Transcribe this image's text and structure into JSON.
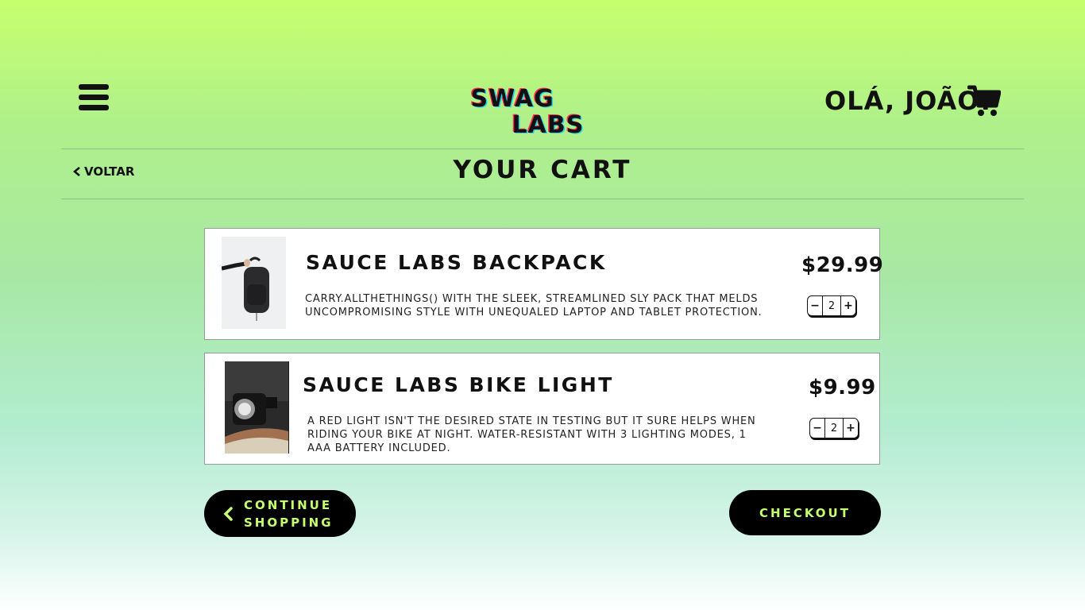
{
  "header": {
    "logo": {
      "line1": "SWAG",
      "line2": "LABS"
    },
    "greeting": "OLÁ, JOÃO!",
    "menu_icon": "hamburger-menu-icon",
    "cart_icon": "shopping-cart-icon"
  },
  "subheader": {
    "back_label": "VOLTAR",
    "title": "YOUR CART"
  },
  "cart": {
    "items": [
      {
        "name": "SAUCE LABS BACKPACK",
        "description": "CARRY.ALLTHETHINGS() WITH THE SLEEK, STREAMLINED SLY PACK THAT MELDS UNCOMPROMISING STYLE WITH UNEQUALED LAPTOP AND TABLET PROTECTION.",
        "price": "$29.99",
        "quantity": "2",
        "image_icon": "backpack-photo"
      },
      {
        "name": "SAUCE LABS BIKE LIGHT",
        "description": "A RED LIGHT ISN'T THE DESIRED STATE IN TESTING BUT IT SURE HELPS WHEN RIDING YOUR BIKE AT NIGHT. WATER-RESISTANT WITH 3 LIGHTING MODES, 1 AAA BATTERY INCLUDED.",
        "price": "$9.99",
        "quantity": "2",
        "image_icon": "bike-light-photo"
      }
    ],
    "qty_minus": "−",
    "qty_plus": "+"
  },
  "actions": {
    "continue_line1": "CONTINUE",
    "continue_line2": "SHOPPING",
    "checkout": "CHECKOUT"
  },
  "colors": {
    "accent": "#c6ff6e",
    "button_bg": "#000000",
    "text": "#111111"
  }
}
